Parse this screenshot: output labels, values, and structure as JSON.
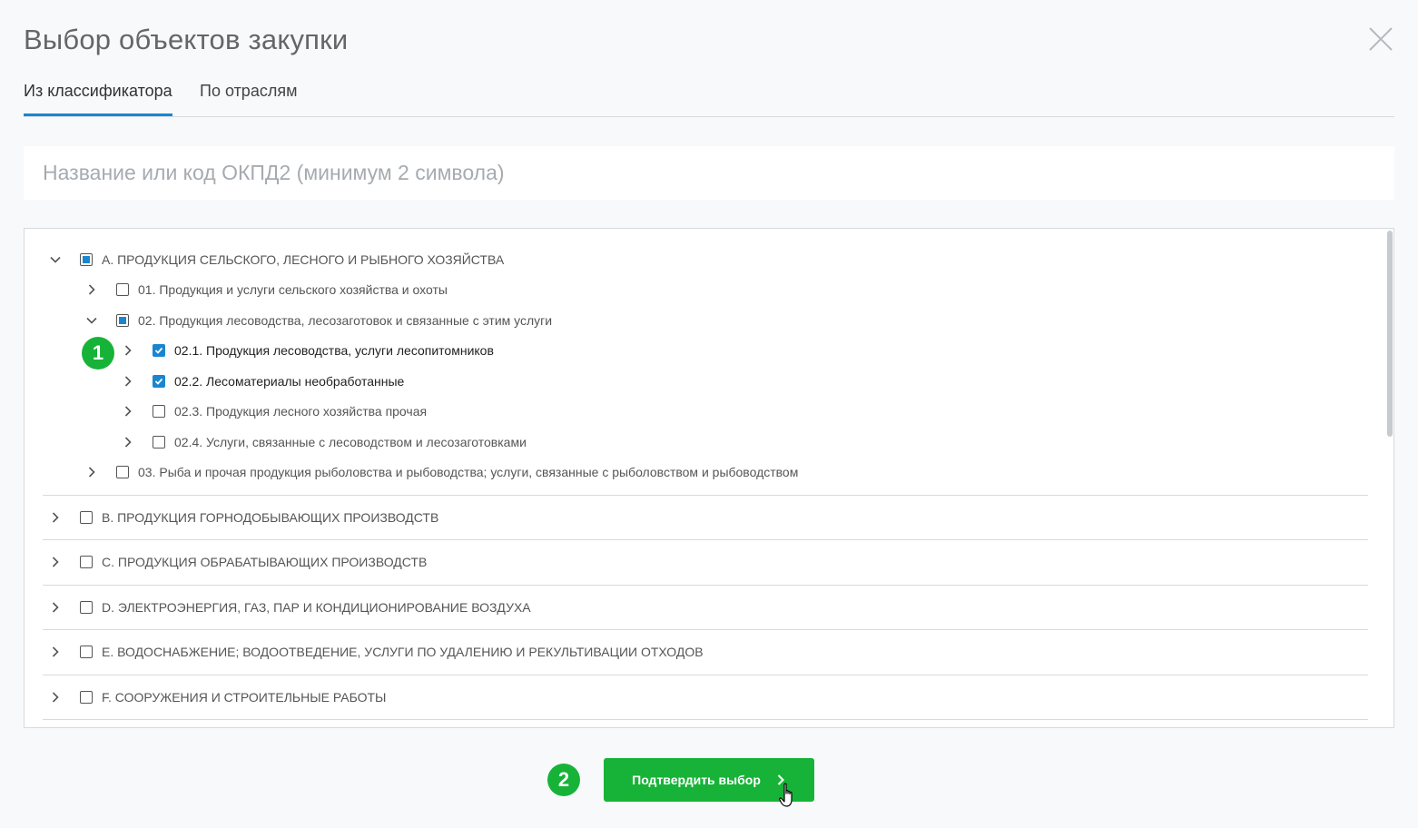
{
  "dialog": {
    "title": "Выбор объектов закупки"
  },
  "tabs": [
    {
      "label": "Из классификатора",
      "active": true
    },
    {
      "label": "По отраслям",
      "active": false
    }
  ],
  "search": {
    "placeholder": "Название или код ОКПД2 (минимум 2 символа)",
    "value": ""
  },
  "tree": {
    "items": [
      {
        "label": "A. ПРОДУКЦИЯ СЕЛЬСКОГО, ЛЕСНОГО И РЫБНОГО ХОЗЯЙСТВА",
        "expanded": true,
        "state": "partial"
      },
      {
        "label": "01. Продукция и услуги сельского хозяйства и охоты",
        "expanded": false,
        "state": "unchecked"
      },
      {
        "label": "02. Продукция лесоводства, лесозаготовок и связанные с этим услуги",
        "expanded": true,
        "state": "partial"
      },
      {
        "label": "02.1. Продукция лесоводства, услуги лесопитомников",
        "expanded": false,
        "state": "checked"
      },
      {
        "label": "02.2. Лесоматериалы необработанные",
        "expanded": false,
        "state": "checked"
      },
      {
        "label": "02.3. Продукция лесного хозяйства прочая",
        "expanded": false,
        "state": "unchecked"
      },
      {
        "label": "02.4. Услуги, связанные с лесоводством и лесозаготовками",
        "expanded": false,
        "state": "unchecked"
      },
      {
        "label": "03. Рыба и прочая продукция рыболовства и рыбоводства; услуги, связанные с рыболовством и рыбоводством",
        "expanded": false,
        "state": "unchecked"
      },
      {
        "label": "B. ПРОДУКЦИЯ ГОРНОДОБЫВАЮЩИХ ПРОИЗВОДСТВ",
        "expanded": false,
        "state": "unchecked"
      },
      {
        "label": "C. ПРОДУКЦИЯ ОБРАБАТЫВАЮЩИХ ПРОИЗВОДСТВ",
        "expanded": false,
        "state": "unchecked"
      },
      {
        "label": "D. ЭЛЕКТРОЭНЕРГИЯ, ГАЗ, ПАР И КОНДИЦИОНИРОВАНИЕ ВОЗДУХА",
        "expanded": false,
        "state": "unchecked"
      },
      {
        "label": "E. ВОДОСНАБЖЕНИЕ; ВОДООТВЕДЕНИЕ, УСЛУГИ ПО УДАЛЕНИЮ И РЕКУЛЬТИВАЦИИ ОТХОДОВ",
        "expanded": false,
        "state": "unchecked"
      },
      {
        "label": "F. СООРУЖЕНИЯ И СТРОИТЕЛЬНЫЕ РАБОТЫ",
        "expanded": false,
        "state": "unchecked"
      }
    ]
  },
  "annotations": {
    "step1": "1",
    "step2": "2"
  },
  "confirm": {
    "label": "Подтвердить выбор"
  },
  "colors": {
    "accent": "#1a86d0",
    "success": "#17b338"
  }
}
